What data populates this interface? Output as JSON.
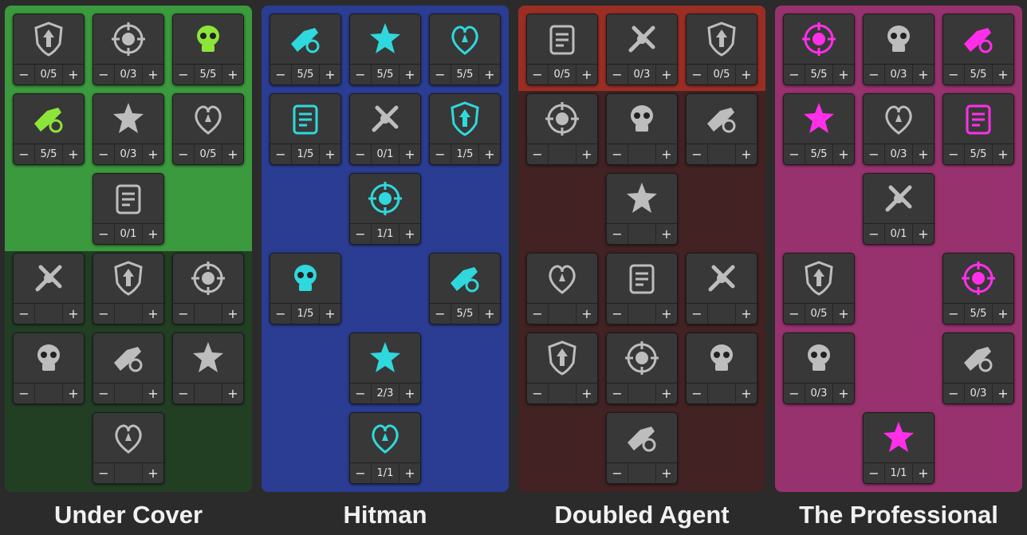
{
  "colors": {
    "under_cover": {
      "top": "#3b9a3d",
      "bottom": "#223f24",
      "icon_active": "#8ce63a"
    },
    "hitman": {
      "top": "#2a3d93",
      "bottom": "#2a3d93",
      "icon_active": "#2fd8dc"
    },
    "doubled_agent": {
      "top": "#9b2e24",
      "bottom": "#422222",
      "icon_active": "#c8c8c8"
    },
    "the_professional": {
      "top": "#98326f",
      "bottom": "#98326f",
      "icon_active": "#ff2fe9"
    },
    "icon_inactive": "#bdbdbd",
    "panel_bg": "#2b2b2b",
    "cell_bg": "#383838"
  },
  "controls": {
    "minus": "−",
    "plus": "+"
  },
  "trees": [
    {
      "id": "under-cover",
      "title": "Under Cover",
      "skills": [
        {
          "icon": "shield-arrow-icon",
          "level": "0/5",
          "active": false
        },
        {
          "icon": "dna-shield-icon",
          "level": "0/3",
          "active": false
        },
        {
          "icon": "hourglass-shield-icon",
          "level": "5/5",
          "active": true
        },
        {
          "icon": "toxic-skull-icon",
          "level": "5/5",
          "active": true
        },
        {
          "icon": "split-shield-icon",
          "level": "0/3",
          "active": false
        },
        {
          "icon": "cross-shield-icon",
          "level": "0/5",
          "active": false
        },
        {
          "icon": "armor-crest-icon",
          "level": "0/1",
          "active": false
        },
        {
          "icon": "frozen-clock-icon",
          "level": "",
          "active": false
        },
        {
          "icon": "frozen-heart-icon",
          "level": "",
          "active": false
        },
        {
          "icon": "grenade-icon",
          "level": "",
          "active": false
        },
        {
          "icon": "frozen-cross-icon",
          "level": "",
          "active": false
        },
        {
          "icon": "ice-swirl-icon",
          "level": "",
          "active": false
        },
        {
          "icon": "crosshair-target-icon",
          "level": "",
          "active": false
        },
        {
          "icon": "knight-helmet-icon",
          "level": "",
          "active": false
        }
      ]
    },
    {
      "id": "hitman",
      "title": "Hitman",
      "skills": [
        {
          "icon": "pistol-icon",
          "level": "5/5",
          "active": true
        },
        {
          "icon": "reload-magazine-icon",
          "level": "5/5",
          "active": true
        },
        {
          "icon": "rabbit-icon",
          "level": "5/5",
          "active": true
        },
        {
          "icon": "ammo-card-icon",
          "level": "1/5",
          "active": true
        },
        {
          "icon": "bomb-hand-icon",
          "level": "0/1",
          "active": false
        },
        {
          "icon": "fanged-mouth-icon",
          "level": "1/5",
          "active": true
        },
        {
          "icon": "skull-tombstone-icon",
          "level": "1/1",
          "active": true
        },
        {
          "icon": "bullet-burst-icon",
          "level": "1/5",
          "active": true
        },
        {
          "icon": "bullet-spread-icon",
          "level": "5/5",
          "active": true
        },
        {
          "icon": "heavy-hammer-icon",
          "level": "2/3",
          "active": true
        },
        {
          "icon": "grim-reaper-icon",
          "level": "1/1",
          "active": true
        }
      ]
    },
    {
      "id": "doubled-agent",
      "title": "Doubled Agent",
      "skills": [
        {
          "icon": "knife-icon",
          "level": "0/5",
          "active": false
        },
        {
          "icon": "ammo-magazine-icon",
          "level": "0/3",
          "active": false
        },
        {
          "icon": "alarm-clock-icon",
          "level": "0/5",
          "active": false
        },
        {
          "icon": "muscle-arms-icon",
          "level": "",
          "active": false
        },
        {
          "icon": "bomb-cloud-icon",
          "level": "",
          "active": false
        },
        {
          "icon": "bandaged-fist-icon",
          "level": "",
          "active": false
        },
        {
          "icon": "broken-shield-icon",
          "level": "",
          "active": false
        },
        {
          "icon": "basket-icon",
          "level": "",
          "active": false
        },
        {
          "icon": "pirate-skull-icon",
          "level": "",
          "active": false
        },
        {
          "icon": "running-rabbit-icon",
          "level": "",
          "active": false
        },
        {
          "icon": "stop-hand-icon",
          "level": "",
          "active": false
        },
        {
          "icon": "muscle-torso-icon",
          "level": "",
          "active": false
        },
        {
          "icon": "twin-hands-icon",
          "level": "",
          "active": false
        },
        {
          "icon": "gun-sparkle-icon",
          "level": "",
          "active": false
        }
      ]
    },
    {
      "id": "the-professional",
      "title": "The Professional",
      "skills": [
        {
          "icon": "star-gun-icon",
          "level": "5/5",
          "active": true
        },
        {
          "icon": "crossbones-skull-icon",
          "level": "0/3",
          "active": false
        },
        {
          "icon": "rocket-icon",
          "level": "5/5",
          "active": true
        },
        {
          "icon": "scope-crosshair-icon",
          "level": "5/5",
          "active": true
        },
        {
          "icon": "winged-dragon-icon",
          "level": "0/3",
          "active": false
        },
        {
          "icon": "arrow-up-icon",
          "level": "5/5",
          "active": true
        },
        {
          "icon": "runner-icon",
          "level": "0/1",
          "active": false
        },
        {
          "icon": "armor-vest-icon",
          "level": "0/5",
          "active": false
        },
        {
          "icon": "grenade-burst-icon",
          "level": "5/5",
          "active": true
        },
        {
          "icon": "skull-compass-icon",
          "level": "0/3",
          "active": false
        },
        {
          "icon": "carrot-blade-icon",
          "level": "0/3",
          "active": false
        },
        {
          "icon": "electric-key-icon",
          "level": "1/1",
          "active": true
        }
      ]
    }
  ]
}
